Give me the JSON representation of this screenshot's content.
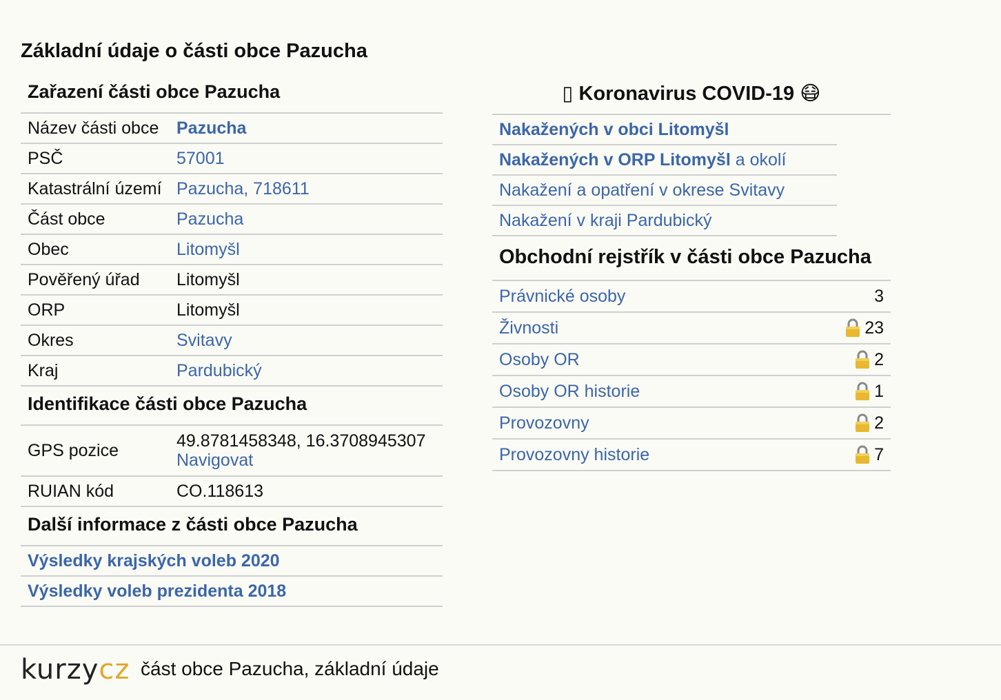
{
  "page_title": "Základní údaje o části obce Pazucha",
  "zarazeni": {
    "heading": "Zařazení části obce Pazucha",
    "rows": [
      {
        "key": "Název části obce",
        "value": "Pazucha",
        "link": true,
        "bold": true
      },
      {
        "key": "PSČ",
        "value": "57001",
        "link": true
      },
      {
        "key": "Katastrální území",
        "value": "Pazucha, 718611",
        "link": true
      },
      {
        "key": "Část obce",
        "value": "Pazucha",
        "link": true
      },
      {
        "key": "Obec",
        "value": "Litomyšl",
        "link": true
      },
      {
        "key": "Pověřený úřad",
        "value": "Litomyšl",
        "link": false
      },
      {
        "key": "ORP",
        "value": "Litomyšl",
        "link": false
      },
      {
        "key": "Okres",
        "value": "Svitavy",
        "link": true
      },
      {
        "key": "Kraj",
        "value": "Pardubický",
        "link": true
      }
    ]
  },
  "identifikace": {
    "heading": "Identifikace části obce Pazucha",
    "gps_label": "GPS pozice",
    "gps_value": "49.8781458348, 16.3708945307",
    "gps_link": "Navigovat",
    "ruian_label": "RUIAN kód",
    "ruian_value": "CO.118613"
  },
  "dalsi": {
    "heading": "Další informace z části obce Pazucha",
    "links": [
      "Výsledky krajských voleb 2020",
      "Výsledky voleb prezidenta 2018"
    ]
  },
  "covid": {
    "heading_prefix": "▯ Koronavirus COVID-19",
    "heading_emoji": "😷",
    "row1": "Nakažených v obci Litomyšl",
    "row2_bold": "Nakažených v ORP Litomyšl",
    "row2_rest": " a okolí",
    "row3": "Nakažení a opatření v okrese Svitavy",
    "row4": "Nakažení v kraji Pardubický"
  },
  "or": {
    "heading": "Obchodní rejstřík v části obce Pazucha",
    "rows": [
      {
        "label": "Právnické osoby",
        "count": "3",
        "locked": false
      },
      {
        "label": "Živnosti",
        "count": "23",
        "locked": true
      },
      {
        "label": "Osoby OR",
        "count": "2",
        "locked": true
      },
      {
        "label": "Osoby OR historie",
        "count": "1",
        "locked": true
      },
      {
        "label": "Provozovny",
        "count": "2",
        "locked": true
      },
      {
        "label": "Provozovny historie",
        "count": "7",
        "locked": true
      }
    ]
  },
  "footer": {
    "logo_a": "kurzy",
    "logo_b": "cz",
    "text": "část obce Pazucha, základní údaje"
  },
  "colors": {
    "link": "#3b66a8",
    "logo_accent": "#e0a82a",
    "lock": "#e8b830"
  }
}
